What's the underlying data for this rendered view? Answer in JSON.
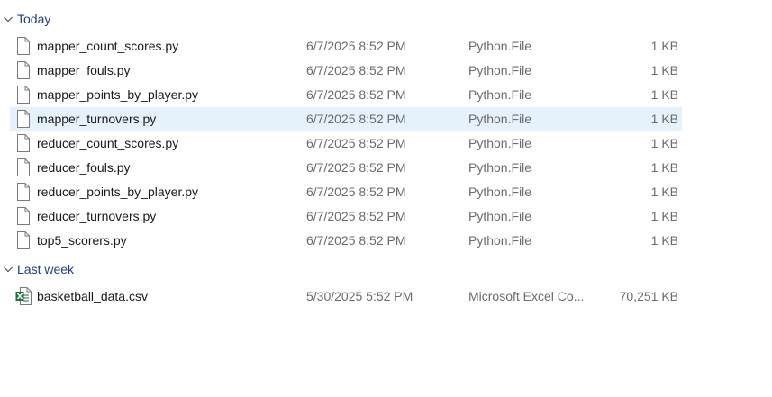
{
  "groups": [
    {
      "label": "Today",
      "files": [
        {
          "name": "mapper_count_scores.py",
          "date": "6/7/2025 8:52 PM",
          "type": "Python.File",
          "size": "1 KB",
          "icon": "python-file-icon"
        },
        {
          "name": "mapper_fouls.py",
          "date": "6/7/2025 8:52 PM",
          "type": "Python.File",
          "size": "1 KB",
          "icon": "python-file-icon"
        },
        {
          "name": "mapper_points_by_player.py",
          "date": "6/7/2025 8:52 PM",
          "type": "Python.File",
          "size": "1 KB",
          "icon": "python-file-icon"
        },
        {
          "name": "mapper_turnovers.py",
          "date": "6/7/2025 8:52 PM",
          "type": "Python.File",
          "size": "1 KB",
          "icon": "python-file-icon",
          "selected": true
        },
        {
          "name": "reducer_count_scores.py",
          "date": "6/7/2025 8:52 PM",
          "type": "Python.File",
          "size": "1 KB",
          "icon": "python-file-icon"
        },
        {
          "name": "reducer_fouls.py",
          "date": "6/7/2025 8:52 PM",
          "type": "Python.File",
          "size": "1 KB",
          "icon": "python-file-icon"
        },
        {
          "name": "reducer_points_by_player.py",
          "date": "6/7/2025 8:52 PM",
          "type": "Python.File",
          "size": "1 KB",
          "icon": "python-file-icon"
        },
        {
          "name": "reducer_turnovers.py",
          "date": "6/7/2025 8:52 PM",
          "type": "Python.File",
          "size": "1 KB",
          "icon": "python-file-icon"
        },
        {
          "name": "top5_scorers.py",
          "date": "6/7/2025 8:52 PM",
          "type": "Python.File",
          "size": "1 KB",
          "icon": "python-file-icon"
        }
      ]
    },
    {
      "label": "Last week",
      "files": [
        {
          "name": "basketball_data.csv",
          "date": "5/30/2025 5:52 PM",
          "type": "Microsoft Excel Co...",
          "size": "70,251 KB",
          "icon": "excel-csv-file-icon"
        }
      ]
    }
  ],
  "colors": {
    "group_label": "#1e3f8a",
    "selected_row": "#e5f1fb",
    "secondary_text": "#6b6b6b",
    "excel_green": "#1d6f42"
  }
}
